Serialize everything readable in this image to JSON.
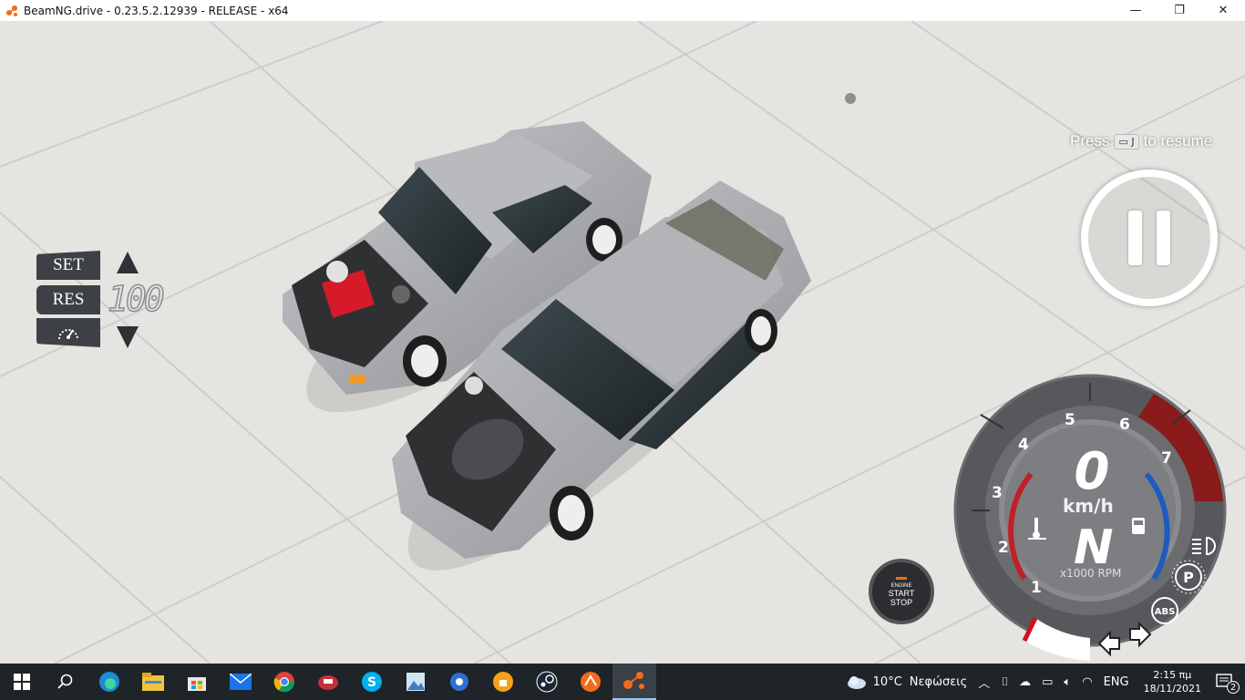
{
  "window": {
    "title": "BeamNG.drive - 0.23.5.2.12939 - RELEASE - x64",
    "minimize": "—",
    "maximize": "❐",
    "close": "✕"
  },
  "cruise_control": {
    "set_label": "SET",
    "res_label": "RES",
    "speed_value": "100"
  },
  "pause": {
    "press": "Press",
    "key": "J",
    "resume": "to resume"
  },
  "engine_button": {
    "line1": "ENGINE",
    "line2": "START",
    "line3": "STOP"
  },
  "gauge": {
    "speed": "0",
    "unit": "km/h",
    "gear": "N",
    "rpm_label": "x1000 RPM",
    "rpm_ticks": [
      "1",
      "2",
      "3",
      "4",
      "5",
      "6",
      "7"
    ],
    "abs_label": "ABS",
    "parking_label": "P",
    "redline_color": "#8b1a1a",
    "temp_color": "#c0202a",
    "fuel_color": "#1e5bbf"
  },
  "taskbar": {
    "apps": [
      "windows-start-icon",
      "search-icon",
      "edge-icon",
      "file-explorer-icon",
      "store-icon",
      "mail-icon",
      "chrome-icon",
      "app-red-icon",
      "skype-icon",
      "photos-icon",
      "app-blue-icon",
      "vpn-icon",
      "steam-icon",
      "app-orange-icon",
      "beamng-icon"
    ],
    "weather_temp": "10°C",
    "weather_text": "Νεφώσεις",
    "language": "ENG",
    "time": "2:15 πμ",
    "date": "18/11/2021",
    "notifications": "2"
  }
}
